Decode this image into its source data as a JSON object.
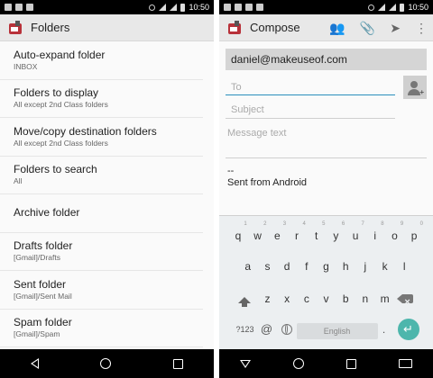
{
  "status_bar": {
    "time": "10:50"
  },
  "left": {
    "app_title": "Folders",
    "items": [
      {
        "title": "Auto-expand folder",
        "summary": "INBOX"
      },
      {
        "title": "Folders to display",
        "summary": "All except 2nd Class folders"
      },
      {
        "title": "Move/copy destination folders",
        "summary": "All except 2nd Class folders"
      },
      {
        "title": "Folders to search",
        "summary": "All"
      },
      {
        "title": "Archive folder",
        "summary": ""
      },
      {
        "title": "Drafts folder",
        "summary": "[Gmail]/Drafts"
      },
      {
        "title": "Sent folder",
        "summary": "[Gmail]/Sent Mail"
      },
      {
        "title": "Spam folder",
        "summary": "[Gmail]/Spam"
      }
    ]
  },
  "right": {
    "app_title": "Compose",
    "from": "daniel@makeuseof.com",
    "to_placeholder": "To",
    "subject_placeholder": "Subject",
    "message_placeholder": "Message text",
    "signature_sep": "--",
    "signature": "Sent from Android",
    "keyboard": {
      "row1": [
        "q",
        "w",
        "e",
        "r",
        "t",
        "y",
        "u",
        "i",
        "o",
        "p"
      ],
      "row1_hints": [
        "1",
        "2",
        "3",
        "4",
        "5",
        "6",
        "7",
        "8",
        "9",
        "0"
      ],
      "row2": [
        "a",
        "s",
        "d",
        "f",
        "g",
        "h",
        "j",
        "k",
        "l"
      ],
      "row3": [
        "z",
        "x",
        "c",
        "v",
        "b",
        "n",
        "m"
      ],
      "symbols_label": "?123",
      "at_label": "@",
      "space_label": "English",
      "enter_label": "↵"
    }
  },
  "icons": {
    "add_contact": "add-contact-icon",
    "attach": "attachment-icon",
    "send": "send-icon",
    "overflow": "overflow-menu-icon"
  },
  "colors": {
    "accent": "#4db6ac",
    "focus_underline": "#2a8fbd",
    "app_icon_red": "#b8323a"
  }
}
